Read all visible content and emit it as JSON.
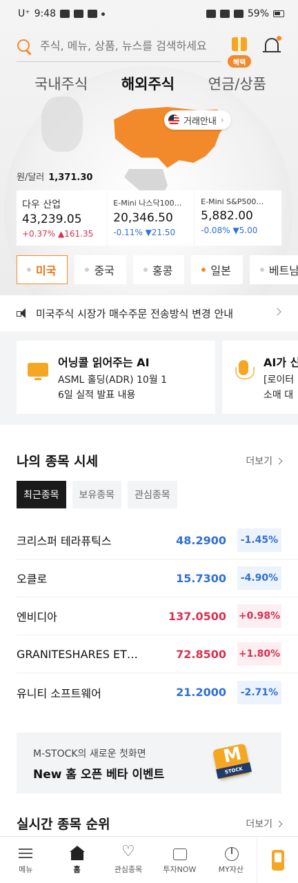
{
  "status_bar": {
    "carrier": "U⁺",
    "time": "9:48",
    "battery": "59%"
  },
  "search": {
    "placeholder": "주식, 메뉴, 상품, 뉴스를 검색하세요"
  },
  "gift": {
    "badge": "혜택"
  },
  "market_tabs": [
    {
      "label": "국내주식",
      "active": false
    },
    {
      "label": "해외주식",
      "active": true
    },
    {
      "label": "연금/상품",
      "active": false
    }
  ],
  "trade_info": {
    "label": "거래안내"
  },
  "fx": {
    "label": "원/달러",
    "value": "1,371.30"
  },
  "indices": [
    {
      "name": "다우 산업",
      "value": "43,239.05",
      "change_pct": "+0.37%",
      "change": "▲161.35",
      "dir": "up"
    },
    {
      "name": "E-Mini 나스닥100…",
      "value": "20,346.50",
      "change_pct": "-0.11%",
      "change": "▼21.50",
      "dir": "down"
    },
    {
      "name": "E-Mini S&P500…",
      "value": "5,882.00",
      "change_pct": "-0.08%",
      "change": "▼5.00",
      "dir": "down"
    }
  ],
  "countries": [
    {
      "label": "미국",
      "active": true,
      "dot": "gray"
    },
    {
      "label": "중국",
      "active": false,
      "dot": "gray"
    },
    {
      "label": "홍콩",
      "active": false,
      "dot": "gray"
    },
    {
      "label": "일본",
      "active": false,
      "dot": "orange"
    },
    {
      "label": "베트남",
      "active": false,
      "dot": "gray"
    }
  ],
  "notice": {
    "text": "미국주식 시장가 매수주문 전송방식 변경 안내"
  },
  "ai_cards": [
    {
      "title": "어닝콜 읽어주는 AI",
      "line1": "ASML 홀딩(ADR) 10월 1",
      "line2": "6일 실적 발표 내용",
      "icon": "monitor-icon"
    },
    {
      "title": "AI가 신",
      "line1": "[로이터",
      "line2": "소매 대",
      "icon": "mic-icon"
    }
  ],
  "my_stocks": {
    "title": "나의 종목 시세",
    "more": "더보기",
    "tabs": [
      {
        "label": "최근종목",
        "active": true
      },
      {
        "label": "보유종목",
        "active": false
      },
      {
        "label": "관심종목",
        "active": false
      }
    ],
    "rows": [
      {
        "name": "크리스퍼 테라퓨틱스",
        "price": "48.2900",
        "change": "-1.45%",
        "dir": "down"
      },
      {
        "name": "오클로",
        "price": "15.7300",
        "change": "-4.90%",
        "dir": "down"
      },
      {
        "name": "엔비디아",
        "price": "137.0500",
        "change": "+0.98%",
        "dir": "up"
      },
      {
        "name": "GRANITESHARES ETF T…",
        "price": "72.8500",
        "change": "+1.80%",
        "dir": "up"
      },
      {
        "name": "유니티 소프트웨어",
        "price": "21.2000",
        "change": "-2.71%",
        "dir": "down"
      }
    ]
  },
  "banner": {
    "subtitle": "M-STOCK의 새로운 첫화면",
    "title": "New 홈 오픈 베타 이벤트",
    "logo_letter": "M",
    "logo_text": "STOCK"
  },
  "realtime": {
    "title": "실시간 종목 순위",
    "more": "더보기"
  },
  "bottom_nav": [
    {
      "label": "메뉴",
      "icon": "menu-icon",
      "active": false
    },
    {
      "label": "홈",
      "icon": "home-icon",
      "active": true
    },
    {
      "label": "관심종목",
      "icon": "heart-icon",
      "active": false
    },
    {
      "label": "투자NOW",
      "icon": "invest-icon",
      "active": false
    },
    {
      "label": "MY자산",
      "icon": "pie-icon",
      "active": false
    }
  ],
  "colors": {
    "accent": "#f28a2c",
    "up": "#d9304f",
    "down": "#2f6fd6"
  }
}
